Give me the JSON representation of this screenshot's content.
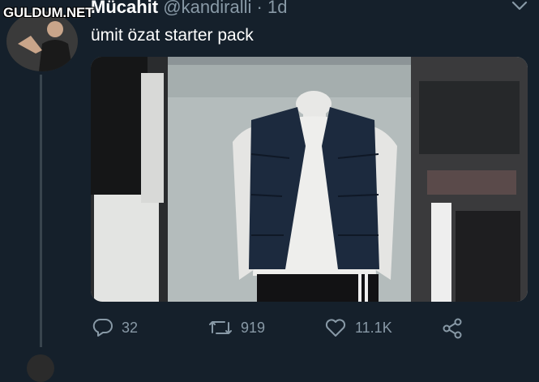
{
  "watermark": "GULDUM.NET",
  "tweet": {
    "display_name": "Mücahit",
    "handle": "@kandiralli",
    "separator": "·",
    "time": "1d",
    "text": "ümit özat starter pack"
  },
  "actions": {
    "replies": "32",
    "retweets": "919",
    "likes": "11.1K"
  },
  "colors": {
    "background": "#15202b",
    "secondary_text": "#8899a6",
    "thread_line": "#38444d"
  },
  "icons": [
    "chevron-down-icon",
    "reply-icon",
    "retweet-icon",
    "like-icon",
    "share-icon"
  ]
}
